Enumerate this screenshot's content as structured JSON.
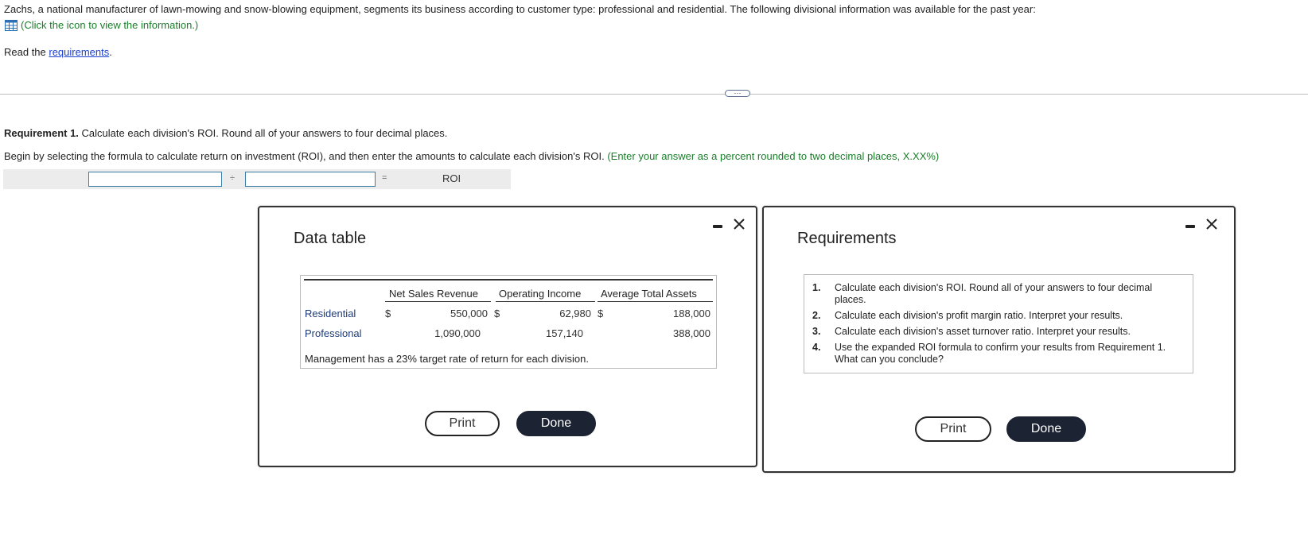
{
  "intro": {
    "text": "Zachs, a national manufacturer of lawn-mowing and snow-blowing equipment, segments its business according to customer type: professional and residential. The following divisional information was available for the past year:",
    "info_link": "(Click the icon to view the information.)",
    "read_prefix": "Read the ",
    "read_link": "requirements",
    "read_suffix": "."
  },
  "more_button": "···",
  "question": {
    "req_bold": "Requirement 1.",
    "req_text": " Calculate each division's ROI. Round all of your answers to four decimal places.",
    "begin_text": "Begin by selecting the formula to calculate return on investment (ROI), and then enter the amounts to calculate each division's ROI. ",
    "begin_hint": "(Enter your answer as a percent rounded to two decimal places, X.XX%)",
    "formula": {
      "input1_value": "",
      "op1": "÷",
      "input2_value": "",
      "op2": "=",
      "result_label": "ROI"
    }
  },
  "data_table": {
    "title": "Data table",
    "headers": [
      "Net Sales Revenue",
      "Operating Income",
      "Average Total Assets"
    ],
    "rows": [
      {
        "label": "Residential",
        "cur1": "$",
        "sales": "550,000",
        "cur2": "$",
        "income": "62,980",
        "cur3": "$",
        "assets": "188,000"
      },
      {
        "label": "Professional",
        "cur1": "",
        "sales": "1,090,000",
        "cur2": "",
        "income": "157,140",
        "cur3": "",
        "assets": "388,000"
      }
    ],
    "note": "Management has a 23% target rate of return for each division.",
    "print_label": "Print",
    "done_label": "Done"
  },
  "requirements": {
    "title": "Requirements",
    "items": [
      {
        "num": "1.",
        "text": "Calculate each division's ROI. Round all of your answers to four decimal places."
      },
      {
        "num": "2.",
        "text": "Calculate each division's profit margin ratio. Interpret your results."
      },
      {
        "num": "3.",
        "text": "Calculate each division's asset turnover ratio. Interpret your results."
      },
      {
        "num": "4.",
        "text": "Use the expanded ROI formula to confirm your results from Requirement 1. What can you conclude?"
      }
    ],
    "print_label": "Print",
    "done_label": "Done"
  },
  "colors": {
    "link_green": "#1a7f2a",
    "link_blue": "#1a3fd1",
    "done_bg": "#1c2333"
  }
}
